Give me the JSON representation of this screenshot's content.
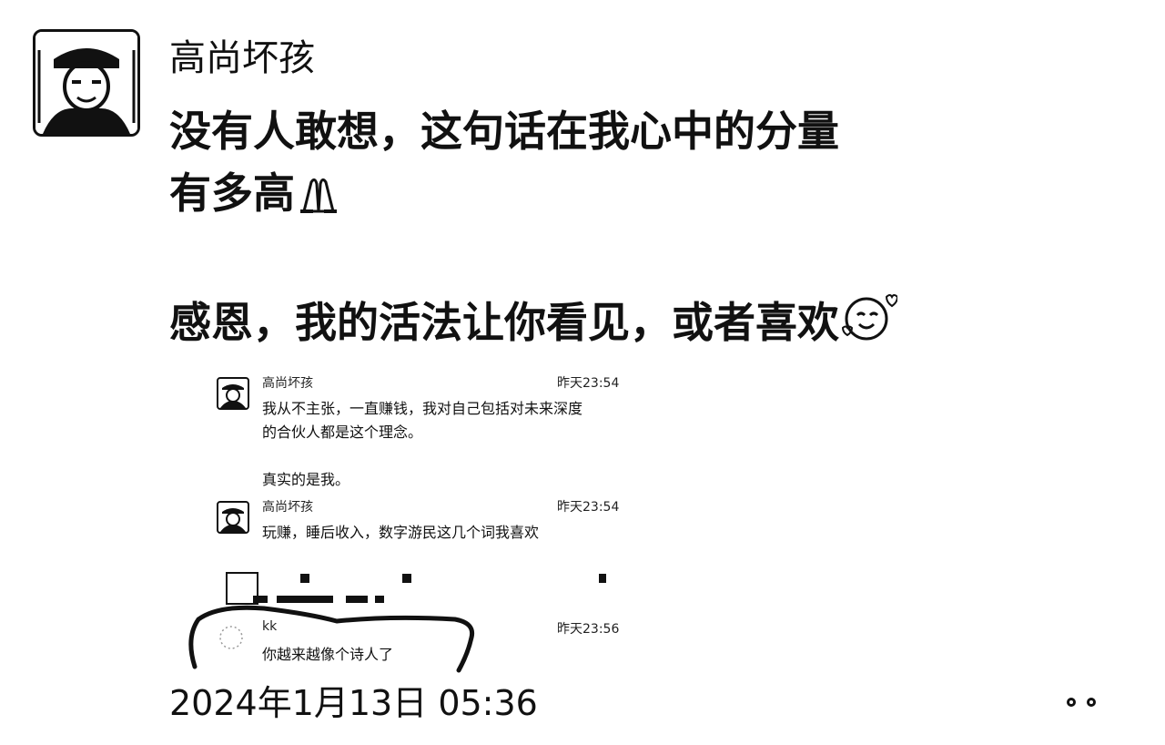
{
  "post": {
    "author": "高尚坏孩",
    "text": "没有人敢想，这句话在我心中的分量\n有多高",
    "text_line2": "\n感恩，我的活法让你看见，或者喜欢",
    "date": "2024年1月13日 05:36"
  },
  "icons": {
    "pray": "folded-hands-emoji",
    "smile": "smiling-face-with-hearts-emoji",
    "more": "more-dots-icon"
  },
  "chat": {
    "messages": [
      {
        "name": "高尚坏孩",
        "time": "昨天23:54",
        "text": "我从不主张，一直赚钱，我对自己包括对未来深度\n的合伙人都是这个理念。\n\n真实的是我。"
      },
      {
        "name": "高尚坏孩",
        "time": "昨天23:54",
        "text": "玩赚，睡后收入，数字游民这几个词我喜欢"
      },
      {
        "name": "kk",
        "time": "昨天23:56",
        "text": "你越来越像个诗人了"
      }
    ]
  }
}
